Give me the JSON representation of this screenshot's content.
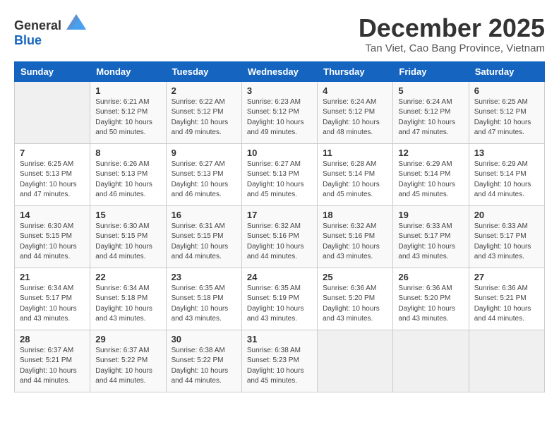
{
  "header": {
    "logo_general": "General",
    "logo_blue": "Blue",
    "title": "December 2025",
    "subtitle": "Tan Viet, Cao Bang Province, Vietnam"
  },
  "weekdays": [
    "Sunday",
    "Monday",
    "Tuesday",
    "Wednesday",
    "Thursday",
    "Friday",
    "Saturday"
  ],
  "weeks": [
    [
      {
        "day": "",
        "detail": ""
      },
      {
        "day": "1",
        "detail": "Sunrise: 6:21 AM\nSunset: 5:12 PM\nDaylight: 10 hours\nand 50 minutes."
      },
      {
        "day": "2",
        "detail": "Sunrise: 6:22 AM\nSunset: 5:12 PM\nDaylight: 10 hours\nand 49 minutes."
      },
      {
        "day": "3",
        "detail": "Sunrise: 6:23 AM\nSunset: 5:12 PM\nDaylight: 10 hours\nand 49 minutes."
      },
      {
        "day": "4",
        "detail": "Sunrise: 6:24 AM\nSunset: 5:12 PM\nDaylight: 10 hours\nand 48 minutes."
      },
      {
        "day": "5",
        "detail": "Sunrise: 6:24 AM\nSunset: 5:12 PM\nDaylight: 10 hours\nand 47 minutes."
      },
      {
        "day": "6",
        "detail": "Sunrise: 6:25 AM\nSunset: 5:12 PM\nDaylight: 10 hours\nand 47 minutes."
      }
    ],
    [
      {
        "day": "7",
        "detail": "Sunrise: 6:25 AM\nSunset: 5:13 PM\nDaylight: 10 hours\nand 47 minutes."
      },
      {
        "day": "8",
        "detail": "Sunrise: 6:26 AM\nSunset: 5:13 PM\nDaylight: 10 hours\nand 46 minutes."
      },
      {
        "day": "9",
        "detail": "Sunrise: 6:27 AM\nSunset: 5:13 PM\nDaylight: 10 hours\nand 46 minutes."
      },
      {
        "day": "10",
        "detail": "Sunrise: 6:27 AM\nSunset: 5:13 PM\nDaylight: 10 hours\nand 45 minutes."
      },
      {
        "day": "11",
        "detail": "Sunrise: 6:28 AM\nSunset: 5:14 PM\nDaylight: 10 hours\nand 45 minutes."
      },
      {
        "day": "12",
        "detail": "Sunrise: 6:29 AM\nSunset: 5:14 PM\nDaylight: 10 hours\nand 45 minutes."
      },
      {
        "day": "13",
        "detail": "Sunrise: 6:29 AM\nSunset: 5:14 PM\nDaylight: 10 hours\nand 44 minutes."
      }
    ],
    [
      {
        "day": "14",
        "detail": "Sunrise: 6:30 AM\nSunset: 5:15 PM\nDaylight: 10 hours\nand 44 minutes."
      },
      {
        "day": "15",
        "detail": "Sunrise: 6:30 AM\nSunset: 5:15 PM\nDaylight: 10 hours\nand 44 minutes."
      },
      {
        "day": "16",
        "detail": "Sunrise: 6:31 AM\nSunset: 5:15 PM\nDaylight: 10 hours\nand 44 minutes."
      },
      {
        "day": "17",
        "detail": "Sunrise: 6:32 AM\nSunset: 5:16 PM\nDaylight: 10 hours\nand 44 minutes."
      },
      {
        "day": "18",
        "detail": "Sunrise: 6:32 AM\nSunset: 5:16 PM\nDaylight: 10 hours\nand 43 minutes."
      },
      {
        "day": "19",
        "detail": "Sunrise: 6:33 AM\nSunset: 5:17 PM\nDaylight: 10 hours\nand 43 minutes."
      },
      {
        "day": "20",
        "detail": "Sunrise: 6:33 AM\nSunset: 5:17 PM\nDaylight: 10 hours\nand 43 minutes."
      }
    ],
    [
      {
        "day": "21",
        "detail": "Sunrise: 6:34 AM\nSunset: 5:17 PM\nDaylight: 10 hours\nand 43 minutes."
      },
      {
        "day": "22",
        "detail": "Sunrise: 6:34 AM\nSunset: 5:18 PM\nDaylight: 10 hours\nand 43 minutes."
      },
      {
        "day": "23",
        "detail": "Sunrise: 6:35 AM\nSunset: 5:18 PM\nDaylight: 10 hours\nand 43 minutes."
      },
      {
        "day": "24",
        "detail": "Sunrise: 6:35 AM\nSunset: 5:19 PM\nDaylight: 10 hours\nand 43 minutes."
      },
      {
        "day": "25",
        "detail": "Sunrise: 6:36 AM\nSunset: 5:20 PM\nDaylight: 10 hours\nand 43 minutes."
      },
      {
        "day": "26",
        "detail": "Sunrise: 6:36 AM\nSunset: 5:20 PM\nDaylight: 10 hours\nand 43 minutes."
      },
      {
        "day": "27",
        "detail": "Sunrise: 6:36 AM\nSunset: 5:21 PM\nDaylight: 10 hours\nand 44 minutes."
      }
    ],
    [
      {
        "day": "28",
        "detail": "Sunrise: 6:37 AM\nSunset: 5:21 PM\nDaylight: 10 hours\nand 44 minutes."
      },
      {
        "day": "29",
        "detail": "Sunrise: 6:37 AM\nSunset: 5:22 PM\nDaylight: 10 hours\nand 44 minutes."
      },
      {
        "day": "30",
        "detail": "Sunrise: 6:38 AM\nSunset: 5:22 PM\nDaylight: 10 hours\nand 44 minutes."
      },
      {
        "day": "31",
        "detail": "Sunrise: 6:38 AM\nSunset: 5:23 PM\nDaylight: 10 hours\nand 45 minutes."
      },
      {
        "day": "",
        "detail": ""
      },
      {
        "day": "",
        "detail": ""
      },
      {
        "day": "",
        "detail": ""
      }
    ]
  ]
}
